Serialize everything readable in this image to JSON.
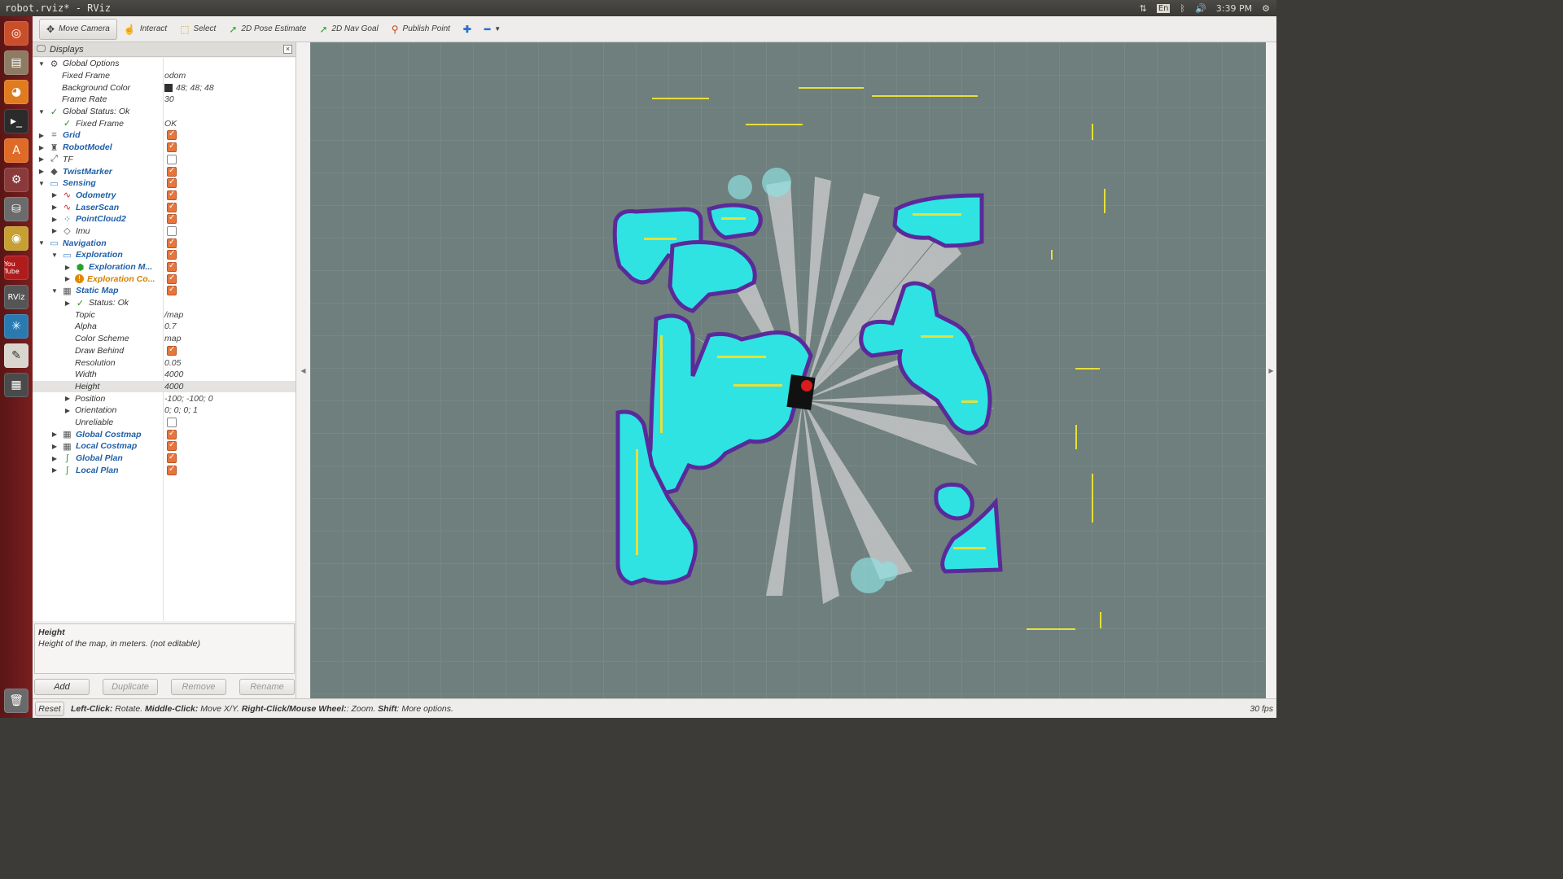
{
  "window": {
    "title": "robot.rviz* - RViz"
  },
  "indicators": {
    "keyboard": "En",
    "clock": "3:39 PM"
  },
  "launcher": {
    "apps": [
      "ubuntu-icon",
      "files-icon",
      "firefox-icon",
      "terminal-icon",
      "software-center-icon",
      "system-settings-icon",
      "drive-icon",
      "gimp-icon",
      "youtube-icon",
      "rviz-icon",
      "app-icon",
      "text-editor-icon",
      "workspace-icon",
      "trash-icon"
    ],
    "labels": {
      "youtube": "You Tube",
      "rviz": "RViz"
    }
  },
  "toolbar": {
    "move_camera": "Move Camera",
    "interact": "Interact",
    "select": "Select",
    "pose_estimate": "2D Pose Estimate",
    "nav_goal": "2D Nav Goal",
    "publish_point": "Publish Point"
  },
  "panel": {
    "title": "Displays",
    "rows": [
      {
        "name": "Global Options",
        "value": "",
        "indent": 0,
        "arrow": "▼",
        "icon": "⚙",
        "bold": false
      },
      {
        "name": "Fixed Frame",
        "value": "odom",
        "indent": 1,
        "arrow": "",
        "icon": "",
        "bold": false
      },
      {
        "name": "Background Color",
        "value": "48; 48; 48",
        "indent": 1,
        "arrow": "",
        "icon": "",
        "bold": false,
        "swatch": true
      },
      {
        "name": "Frame Rate",
        "value": "30",
        "indent": 1,
        "arrow": "",
        "icon": "",
        "bold": false
      },
      {
        "name": "Global Status: Ok",
        "value": "",
        "indent": 0,
        "arrow": "▼",
        "icon": "✓",
        "bold": false
      },
      {
        "name": "Fixed Frame",
        "value": "OK",
        "indent": 1,
        "arrow": "",
        "icon": "✓",
        "bold": false
      },
      {
        "name": "Grid",
        "value": "",
        "indent": 0,
        "arrow": "▶",
        "icon": "⌗",
        "bold": true,
        "check": true
      },
      {
        "name": "RobotModel",
        "value": "",
        "indent": 0,
        "arrow": "▶",
        "icon": "♜",
        "bold": true,
        "check": true
      },
      {
        "name": "TF",
        "value": "",
        "indent": 0,
        "arrow": "▶",
        "icon": "⤢",
        "bold": false,
        "check": false
      },
      {
        "name": "TwistMarker",
        "value": "",
        "indent": 0,
        "arrow": "▶",
        "icon": "◆",
        "bold": true,
        "check": true
      },
      {
        "name": "Sensing",
        "value": "",
        "indent": 0,
        "arrow": "▼",
        "icon": "▭",
        "bold": true,
        "check": true
      },
      {
        "name": "Odometry",
        "value": "",
        "indent": 1,
        "arrow": "▶",
        "icon": "∿",
        "bold": true,
        "check": true
      },
      {
        "name": "LaserScan",
        "value": "",
        "indent": 1,
        "arrow": "▶",
        "icon": "∿",
        "bold": true,
        "check": true
      },
      {
        "name": "PointCloud2",
        "value": "",
        "indent": 1,
        "arrow": "▶",
        "icon": "⁘",
        "bold": true,
        "check": true
      },
      {
        "name": "Imu",
        "value": "",
        "indent": 1,
        "arrow": "▶",
        "icon": "◇",
        "bold": false,
        "check": false
      },
      {
        "name": "Navigation",
        "value": "",
        "indent": 0,
        "arrow": "▼",
        "icon": "▭",
        "bold": true,
        "check": true
      },
      {
        "name": "Exploration",
        "value": "",
        "indent": 1,
        "arrow": "▼",
        "icon": "▭",
        "bold": true,
        "check": true
      },
      {
        "name": "Exploration M...",
        "value": "",
        "indent": 2,
        "arrow": "▶",
        "icon": "⬢",
        "bold": true,
        "check": true
      },
      {
        "name": "Exploration Co...",
        "value": "",
        "indent": 2,
        "arrow": "▶",
        "icon": "!",
        "bold": true,
        "orange": true,
        "check": true
      },
      {
        "name": "Static Map",
        "value": "",
        "indent": 1,
        "arrow": "▼",
        "icon": "▦",
        "bold": true,
        "check": true
      },
      {
        "name": "Status: Ok",
        "value": "",
        "indent": 2,
        "arrow": "▶",
        "icon": "✓",
        "bold": false
      },
      {
        "name": "Topic",
        "value": "/map",
        "indent": 2,
        "arrow": "",
        "icon": "",
        "bold": false
      },
      {
        "name": "Alpha",
        "value": "0.7",
        "indent": 2,
        "arrow": "",
        "icon": "",
        "bold": false
      },
      {
        "name": "Color Scheme",
        "value": "map",
        "indent": 2,
        "arrow": "",
        "icon": "",
        "bold": false
      },
      {
        "name": "Draw Behind",
        "value": "",
        "indent": 2,
        "arrow": "",
        "icon": "",
        "bold": false,
        "check": true
      },
      {
        "name": "Resolution",
        "value": "0.05",
        "indent": 2,
        "arrow": "",
        "icon": "",
        "bold": false
      },
      {
        "name": "Width",
        "value": "4000",
        "indent": 2,
        "arrow": "",
        "icon": "",
        "bold": false
      },
      {
        "name": "Height",
        "value": "4000",
        "indent": 2,
        "arrow": "",
        "icon": "",
        "bold": false,
        "selected": true
      },
      {
        "name": "Position",
        "value": "-100; -100; 0",
        "indent": 2,
        "arrow": "▶",
        "icon": "",
        "bold": false
      },
      {
        "name": "Orientation",
        "value": "0; 0; 0; 1",
        "indent": 2,
        "arrow": "▶",
        "icon": "",
        "bold": false
      },
      {
        "name": "Unreliable",
        "value": "",
        "indent": 2,
        "arrow": "",
        "icon": "",
        "bold": false,
        "check": false
      },
      {
        "name": "Global Costmap",
        "value": "",
        "indent": 1,
        "arrow": "▶",
        "icon": "▦",
        "bold": true,
        "check": true
      },
      {
        "name": "Local Costmap",
        "value": "",
        "indent": 1,
        "arrow": "▶",
        "icon": "▦",
        "bold": true,
        "check": true
      },
      {
        "name": "Global Plan",
        "value": "",
        "indent": 1,
        "arrow": "▶",
        "icon": "∫",
        "bold": true,
        "check": true
      },
      {
        "name": "Local Plan",
        "value": "",
        "indent": 1,
        "arrow": "▶",
        "icon": "∫",
        "bold": true,
        "check": true
      }
    ],
    "description": {
      "title": "Height",
      "text": "Height of the map, in meters. (not editable)"
    },
    "buttons": {
      "add": "Add",
      "duplicate": "Duplicate",
      "remove": "Remove",
      "rename": "Rename"
    }
  },
  "status": {
    "reset": "Reset",
    "hint_left_bold": "Left-Click:",
    "hint_left": " Rotate. ",
    "hint_middle_bold": "Middle-Click:",
    "hint_middle": " Move X/Y. ",
    "hint_right_bold": "Right-Click/Mouse Wheel:",
    "hint_right": ": Zoom. ",
    "hint_shift_bold": "Shift",
    "hint_shift": ": More options.",
    "fps": "30 fps"
  },
  "colors": {
    "viewport_bg": "#6e7f7d",
    "grid": "#8a9997",
    "costmap": "#2fe3e3",
    "inflation": "#5a2a9a",
    "obstacle": "#e5e03a",
    "free": "#c6c6c6",
    "accent": "#e8753a"
  }
}
